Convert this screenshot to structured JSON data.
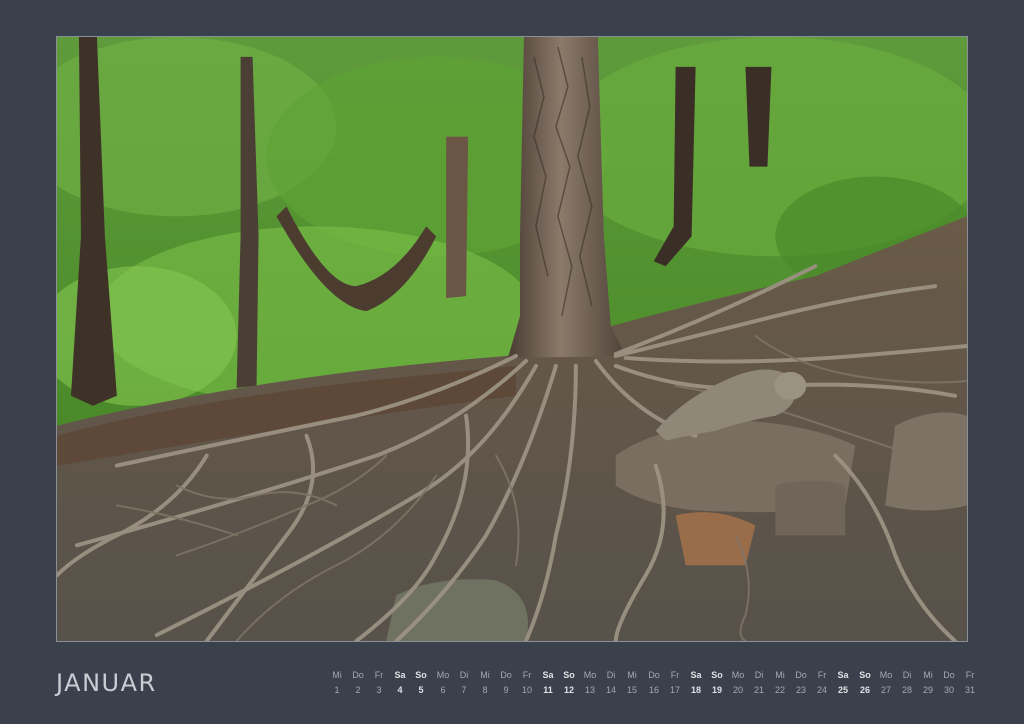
{
  "calendar": {
    "month": "JANUAR",
    "days": [
      {
        "wd": "Mi",
        "n": "1",
        "we": false
      },
      {
        "wd": "Do",
        "n": "2",
        "we": false
      },
      {
        "wd": "Fr",
        "n": "3",
        "we": false
      },
      {
        "wd": "Sa",
        "n": "4",
        "we": true
      },
      {
        "wd": "So",
        "n": "5",
        "we": true
      },
      {
        "wd": "Mo",
        "n": "6",
        "we": false
      },
      {
        "wd": "Di",
        "n": "7",
        "we": false
      },
      {
        "wd": "Mi",
        "n": "8",
        "we": false
      },
      {
        "wd": "Do",
        "n": "9",
        "we": false
      },
      {
        "wd": "Fr",
        "n": "10",
        "we": false
      },
      {
        "wd": "Sa",
        "n": "11",
        "we": true
      },
      {
        "wd": "So",
        "n": "12",
        "we": true
      },
      {
        "wd": "Mo",
        "n": "13",
        "we": false
      },
      {
        "wd": "Di",
        "n": "14",
        "we": false
      },
      {
        "wd": "Mi",
        "n": "15",
        "we": false
      },
      {
        "wd": "Do",
        "n": "16",
        "we": false
      },
      {
        "wd": "Fr",
        "n": "17",
        "we": false
      },
      {
        "wd": "Sa",
        "n": "18",
        "we": true
      },
      {
        "wd": "So",
        "n": "19",
        "we": true
      },
      {
        "wd": "Mo",
        "n": "20",
        "we": false
      },
      {
        "wd": "Di",
        "n": "21",
        "we": false
      },
      {
        "wd": "Mi",
        "n": "22",
        "we": false
      },
      {
        "wd": "Do",
        "n": "23",
        "we": false
      },
      {
        "wd": "Fr",
        "n": "24",
        "we": false
      },
      {
        "wd": "Sa",
        "n": "25",
        "we": true
      },
      {
        "wd": "So",
        "n": "26",
        "we": true
      },
      {
        "wd": "Mo",
        "n": "27",
        "we": false
      },
      {
        "wd": "Di",
        "n": "28",
        "we": false
      },
      {
        "wd": "Mi",
        "n": "29",
        "we": false
      },
      {
        "wd": "Do",
        "n": "30",
        "we": false
      },
      {
        "wd": "Fr",
        "n": "31",
        "we": false
      }
    ]
  },
  "colors": {
    "background": "#3b414c",
    "text": "#a4a8b0",
    "weekend": "#dfe1e5"
  }
}
